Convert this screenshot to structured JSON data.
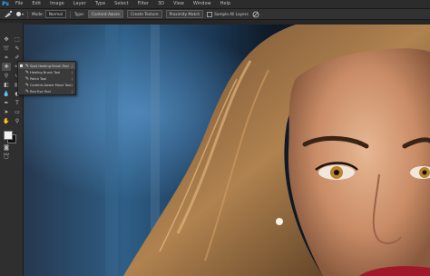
{
  "app": {
    "logo_text": "Ps",
    "accent": "#31a8ff"
  },
  "menu": [
    "File",
    "Edit",
    "Image",
    "Layer",
    "Type",
    "Select",
    "Filter",
    "3D",
    "View",
    "Window",
    "Help"
  ],
  "options": {
    "mode_label": "Mode:",
    "mode_value": "Normal",
    "type_label": "Type:",
    "type_buttons": [
      "Content-Aware",
      "Create Texture",
      "Proximity Match"
    ],
    "sample_all_layers": "Sample All Layers"
  },
  "tool_flyout": [
    {
      "label": "Spot Healing Brush Tool",
      "shortcut": "J",
      "icon": "spot-healing-brush-icon",
      "active": true
    },
    {
      "label": "Healing Brush Tool",
      "shortcut": "J",
      "icon": "healing-brush-icon",
      "active": false
    },
    {
      "label": "Patch Tool",
      "shortcut": "J",
      "icon": "patch-icon",
      "active": false
    },
    {
      "label": "Content-Aware Move Tool",
      "shortcut": "J",
      "icon": "content-aware-move-icon",
      "active": false
    },
    {
      "label": "Red Eye Tool",
      "shortcut": "J",
      "icon": "red-eye-icon",
      "active": false
    }
  ],
  "toolbar": [
    {
      "name": "move-tool-icon",
      "glyph": "✥"
    },
    {
      "name": "marquee-tool-icon",
      "glyph": "⬚"
    },
    {
      "name": "lasso-tool-icon",
      "glyph": "➰"
    },
    {
      "name": "quick-selection-tool-icon",
      "glyph": "✎"
    },
    {
      "name": "crop-tool-icon",
      "glyph": "⌗"
    },
    {
      "name": "eyedropper-tool-icon",
      "glyph": "✐"
    },
    {
      "name": "healing-brush-tool-icon",
      "glyph": "✚"
    },
    {
      "name": "brush-tool-icon",
      "glyph": "✏"
    },
    {
      "name": "clone-stamp-tool-icon",
      "glyph": "⚲"
    },
    {
      "name": "history-brush-tool-icon",
      "glyph": "↺"
    },
    {
      "name": "eraser-tool-icon",
      "glyph": "◧"
    },
    {
      "name": "gradient-tool-icon",
      "glyph": "▤"
    },
    {
      "name": "blur-tool-icon",
      "glyph": "💧"
    },
    {
      "name": "dodge-tool-icon",
      "glyph": "●"
    },
    {
      "name": "pen-tool-icon",
      "glyph": "✒"
    },
    {
      "name": "type-tool-icon",
      "glyph": "T"
    },
    {
      "name": "path-selection-tool-icon",
      "glyph": "➤"
    },
    {
      "name": "rectangle-tool-icon",
      "glyph": "▭"
    },
    {
      "name": "hand-tool-icon",
      "glyph": "✋"
    },
    {
      "name": "zoom-tool-icon",
      "glyph": "⚲"
    },
    {
      "name": "more-tools-icon",
      "glyph": "•••"
    }
  ],
  "colors": {
    "foreground": "#f2f2f2",
    "background": "#111111"
  }
}
